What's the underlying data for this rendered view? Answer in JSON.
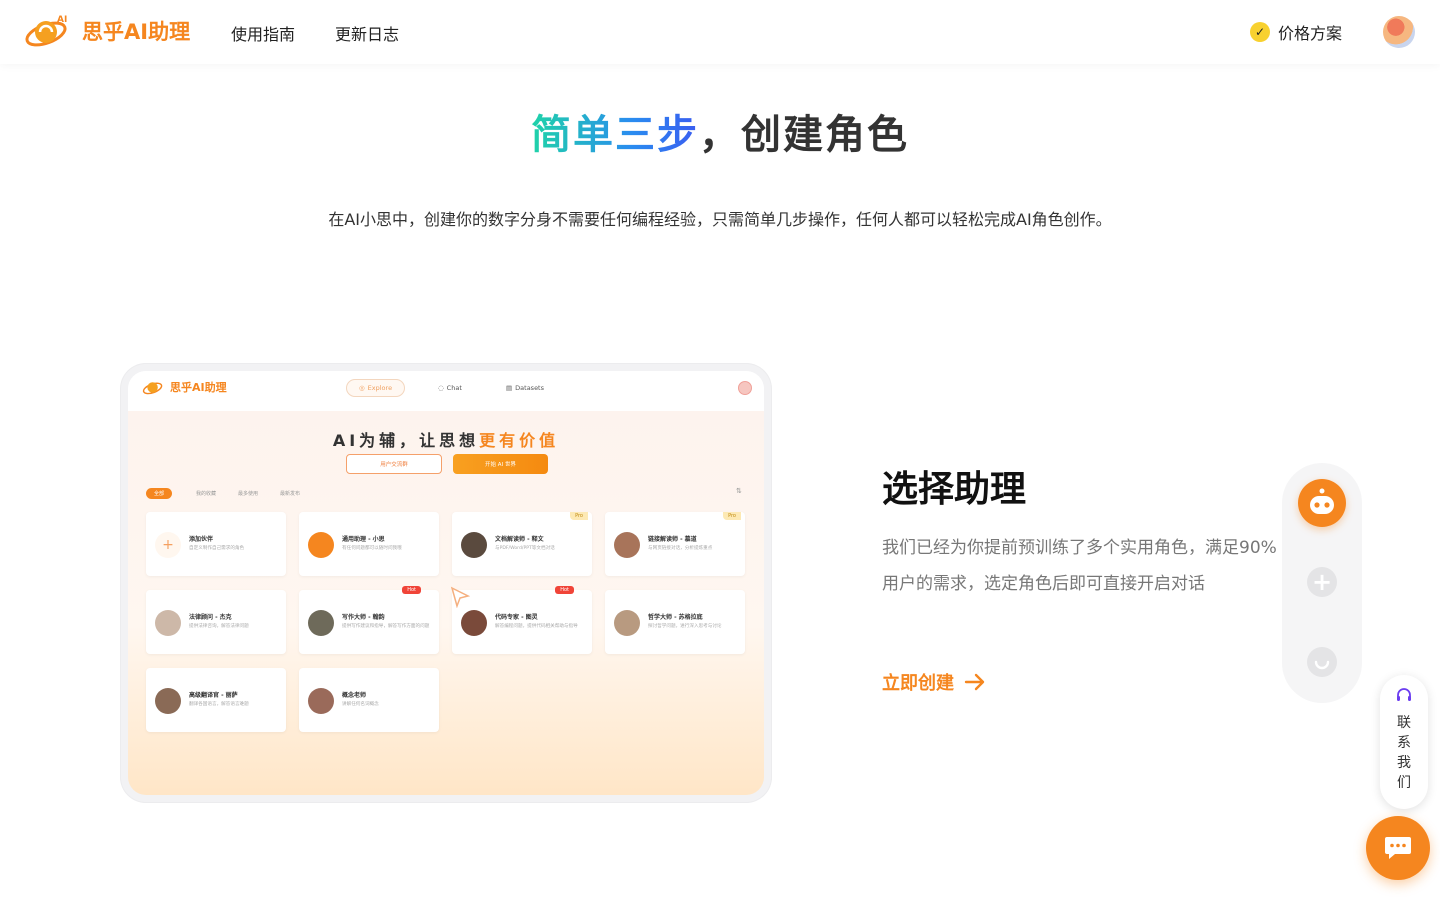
{
  "header": {
    "logo_text": "思乎AI助理",
    "nav": [
      "使用指南",
      "更新日志"
    ],
    "pricing_label": "价格方案"
  },
  "hero": {
    "title_highlight": "简单三步",
    "title_rest": "，创建角色",
    "subtitle": "在AI小思中，创建你的数字分身不需要任何编程经验，只需简单几步操作，任何人都可以轻松完成AI角色创作。"
  },
  "mockup": {
    "logo_text": "思乎AI助理",
    "tabs": [
      "Explore",
      "Chat",
      "Datasets"
    ],
    "slogan_main": "AI为辅，让思想",
    "slogan_highlight": "更有价值",
    "btn_ghost": "用户交流群",
    "btn_solid": "开始 AI 世界",
    "filters": [
      "全部",
      "我的收藏",
      "最多使用",
      "最新发布"
    ],
    "sort_icon": "⇅",
    "cards": [
      {
        "name": "添加伙伴",
        "desc": "自定义制作自己需求的角色"
      },
      {
        "name": "通用助理 - 小思",
        "desc": "有任何问题都可以随时问我哦"
      },
      {
        "name": "文档解读师 - 释文",
        "desc": "与PDF/Word/PPT等文档对话",
        "badge": "Pro"
      },
      {
        "name": "链接解读师 - 慕道",
        "desc": "与网页链接对话，分析提炼重点",
        "badge": "Pro"
      },
      {
        "name": "法律顾问 - 杰克",
        "desc": "提供法律咨询，解答法律问题"
      },
      {
        "name": "写作大师 - 翰韵",
        "desc": "提供写作建议和指导，解答写作方面的问题",
        "badge": "Hot"
      },
      {
        "name": "代码专家 - 图灵",
        "desc": "解答编程问题，提供代码相关帮助与指导",
        "badge": "Hot"
      },
      {
        "name": "哲学大师 - 苏格拉底",
        "desc": "探讨哲学问题，进行深入思考与讨论"
      },
      {
        "name": "高级翻译官 - 丽萨",
        "desc": "翻译各国语言，解答语言难题"
      },
      {
        "name": "概念老师",
        "desc": "讲解任何名词概念"
      }
    ]
  },
  "step": {
    "title": "选择助理",
    "desc": "我们已经为你提前预训练了多个实用角色，满足90%用户的需求，选定角色后即可直接开启对话",
    "link": "立即创建"
  },
  "contact_label": "联系我们",
  "colors": {
    "brand": "#f5861f",
    "gradient_start": "#1fd3a8",
    "gradient_end": "#3a5cf0"
  }
}
